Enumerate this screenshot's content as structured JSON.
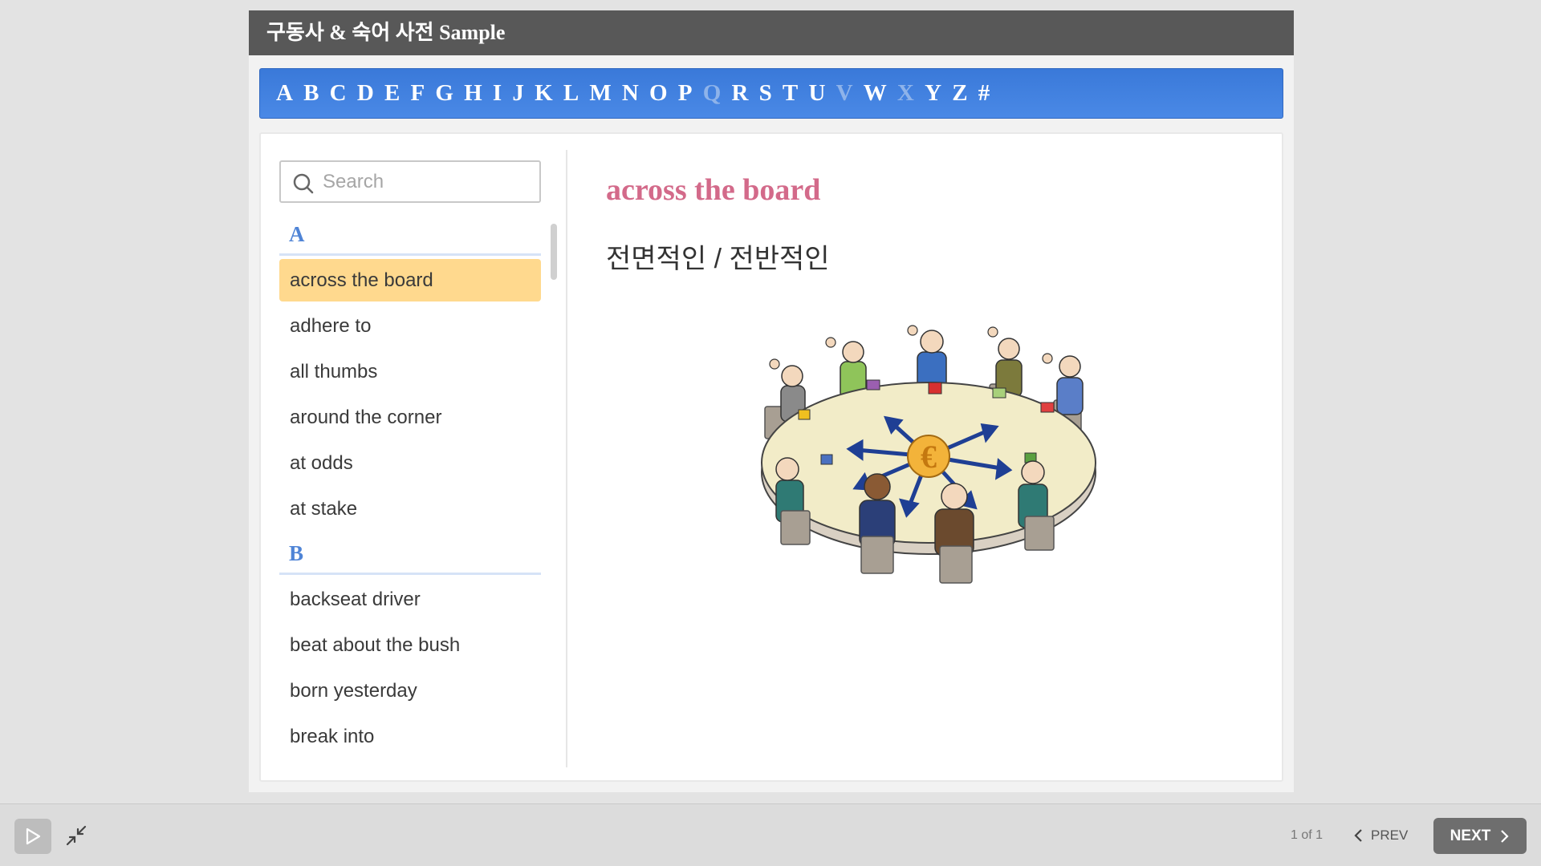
{
  "title": "구동사 & 숙어 사전 Sample",
  "alphabet": [
    {
      "letter": "A",
      "enabled": true
    },
    {
      "letter": "B",
      "enabled": true
    },
    {
      "letter": "C",
      "enabled": true
    },
    {
      "letter": "D",
      "enabled": true
    },
    {
      "letter": "E",
      "enabled": true
    },
    {
      "letter": "F",
      "enabled": true
    },
    {
      "letter": "G",
      "enabled": true
    },
    {
      "letter": "H",
      "enabled": true
    },
    {
      "letter": "I",
      "enabled": true
    },
    {
      "letter": "J",
      "enabled": true
    },
    {
      "letter": "K",
      "enabled": true
    },
    {
      "letter": "L",
      "enabled": true
    },
    {
      "letter": "M",
      "enabled": true
    },
    {
      "letter": "N",
      "enabled": true
    },
    {
      "letter": "O",
      "enabled": true
    },
    {
      "letter": "P",
      "enabled": true
    },
    {
      "letter": "Q",
      "enabled": false
    },
    {
      "letter": "R",
      "enabled": true
    },
    {
      "letter": "S",
      "enabled": true
    },
    {
      "letter": "T",
      "enabled": true
    },
    {
      "letter": "U",
      "enabled": true
    },
    {
      "letter": "V",
      "enabled": false
    },
    {
      "letter": "W",
      "enabled": true
    },
    {
      "letter": "X",
      "enabled": false
    },
    {
      "letter": "Y",
      "enabled": true
    },
    {
      "letter": "Z",
      "enabled": true
    },
    {
      "letter": "#",
      "enabled": true
    }
  ],
  "search": {
    "placeholder": "Search",
    "value": ""
  },
  "sections": [
    {
      "letter": "A",
      "words": [
        "across the board",
        "adhere to",
        "all thumbs",
        "around the corner",
        "at odds",
        "at stake"
      ]
    },
    {
      "letter": "B",
      "words": [
        "backseat driver",
        "beat about the bush",
        "born yesterday",
        "break into"
      ]
    }
  ],
  "selected_word": "across the board",
  "detail": {
    "term": "across the board",
    "meaning": "전면적인 / 전반적인",
    "image_icon": "round-table-meeting-illustration"
  },
  "footer": {
    "page_count": "1 of 1",
    "prev_label": "PREV",
    "next_label": "NEXT"
  },
  "colors": {
    "titlebar": "#585858",
    "alphabar": "#4384e0",
    "term": "#d36a8a",
    "section_head": "#4f84d6",
    "selected_bg": "#ffd98e"
  }
}
